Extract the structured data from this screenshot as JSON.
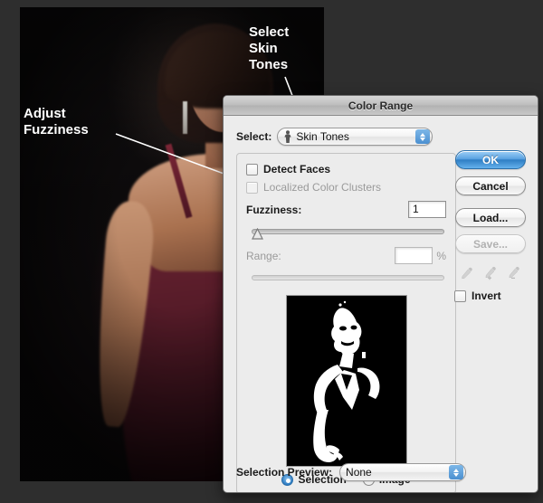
{
  "annotations": [
    {
      "id": "adjust-fuzziness",
      "line1": "Adjust",
      "line2": "Fuzziness"
    },
    {
      "id": "select-skin-tones",
      "line1": "Select",
      "line2": "Skin",
      "line3": "Tones"
    }
  ],
  "dialog": {
    "title": "Color Range",
    "select": {
      "label": "Select:",
      "value": "Skin Tones",
      "icon": "person-icon"
    },
    "checkboxes": [
      {
        "label": "Detect Faces",
        "checked": false,
        "enabled": true
      },
      {
        "label": "Localized Color Clusters",
        "checked": false,
        "enabled": false
      }
    ],
    "fuzziness": {
      "label": "Fuzziness:",
      "value": "1",
      "slider_position_pct": 0,
      "enabled": true
    },
    "range": {
      "label": "Range:",
      "value": "",
      "unit": "%",
      "enabled": false
    },
    "preview_mode": {
      "options": [
        {
          "label": "Selection",
          "selected": true
        },
        {
          "label": "Image",
          "selected": false
        }
      ]
    },
    "selection_preview": {
      "label": "Selection Preview:",
      "value": "None"
    },
    "buttons": [
      {
        "label": "OK",
        "style": "primary",
        "enabled": true
      },
      {
        "label": "Cancel",
        "style": "default",
        "enabled": true
      },
      {
        "label": "Load...",
        "style": "default",
        "enabled": true
      },
      {
        "label": "Save...",
        "style": "default",
        "enabled": false
      }
    ],
    "eyedroppers": [
      {
        "name": "eyedropper-icon",
        "enabled": false
      },
      {
        "name": "eyedropper-add-icon",
        "enabled": false
      },
      {
        "name": "eyedropper-subtract-icon",
        "enabled": false
      }
    ],
    "invert": {
      "label": "Invert",
      "checked": false
    }
  },
  "colors": {
    "accent": "#2f7ec4",
    "dialog_bg": "#ececec",
    "titlebar": "#bdbdbd",
    "desktop_bg": "#2e2e2e",
    "mask_fg": "#ffffff",
    "mask_bg": "#000000"
  }
}
